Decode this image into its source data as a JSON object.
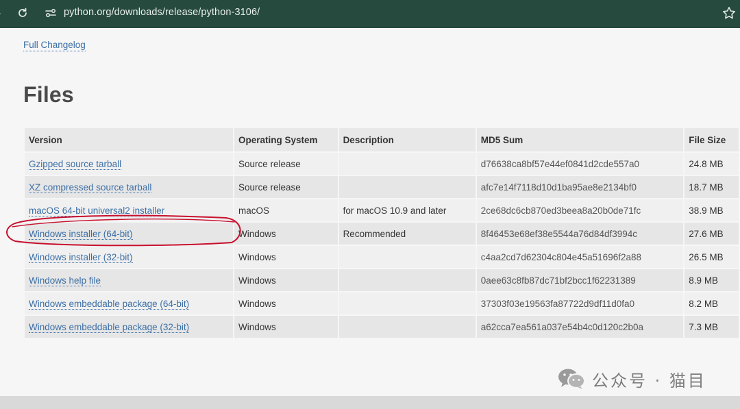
{
  "browser": {
    "url": "python.org/downloads/release/python-3106/"
  },
  "page": {
    "changelog_link": "Full Changelog",
    "files_heading": "Files"
  },
  "table": {
    "headers": [
      "Version",
      "Operating System",
      "Description",
      "MD5 Sum",
      "File Size"
    ],
    "rows": [
      {
        "version": "Gzipped source tarball",
        "os": "Source release",
        "description": "",
        "md5": "d76638ca8bf57e44ef0841d2cde557a0",
        "size": "24.8 MB"
      },
      {
        "version": "XZ compressed source tarball",
        "os": "Source release",
        "description": "",
        "md5": "afc7e14f7118d10d1ba95ae8e2134bf0",
        "size": "18.7 MB"
      },
      {
        "version": "macOS 64-bit universal2 installer",
        "os": "macOS",
        "description": "for macOS 10.9 and later",
        "md5": "2ce68dc6cb870ed3beea8a20b0de71fc",
        "size": "38.9 MB"
      },
      {
        "version": "Windows installer (64-bit)",
        "os": "Windows",
        "description": "Recommended",
        "md5": "8f46453e68ef38e5544a76d84df3994c",
        "size": "27.6 MB"
      },
      {
        "version": "Windows installer (32-bit)",
        "os": "Windows",
        "description": "",
        "md5": "c4aa2cd7d62304c804e45a51696f2a88",
        "size": "26.5 MB"
      },
      {
        "version": "Windows help file",
        "os": "Windows",
        "description": "",
        "md5": "0aee63c8fb87dc71bf2bcc1f62231389",
        "size": "8.9 MB"
      },
      {
        "version": "Windows embeddable package (64-bit)",
        "os": "Windows",
        "description": "",
        "md5": "37303f03e19563fa87722d9df11d0fa0",
        "size": "8.2 MB"
      },
      {
        "version": "Windows embeddable package (32-bit)",
        "os": "Windows",
        "description": "",
        "md5": "a62cca7ea561a037e54b4c0d120c2b0a",
        "size": "7.3 MB"
      }
    ]
  },
  "watermark": {
    "text": "公众号 · 猫目",
    "icon": "wechat-icon"
  },
  "colors": {
    "chrome_bar": "#274a3e",
    "link": "#3a6ea5",
    "annotation": "#c8102e"
  }
}
